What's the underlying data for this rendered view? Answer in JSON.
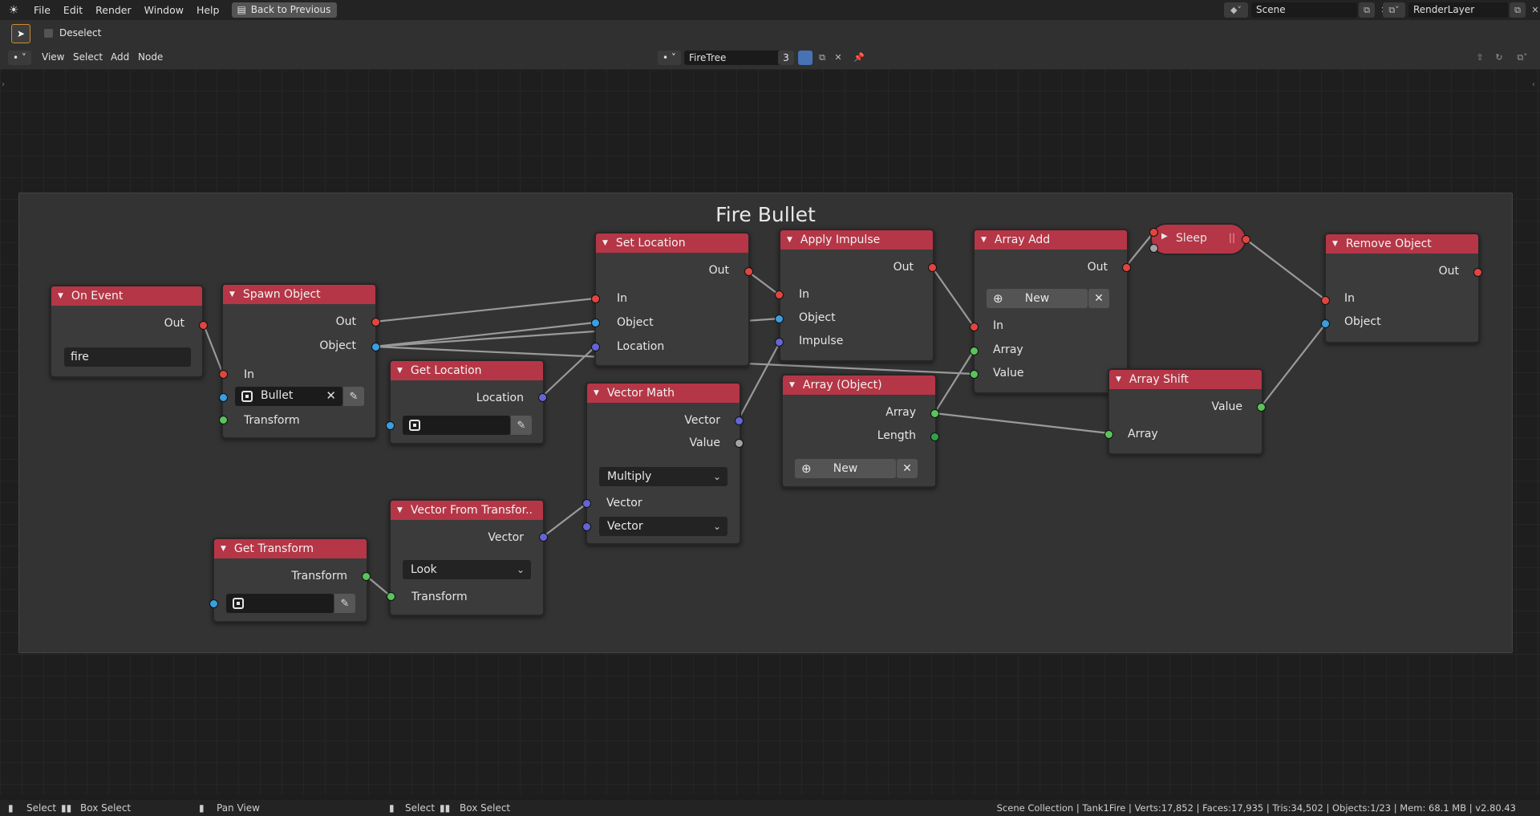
{
  "topbar": {
    "menus": [
      "File",
      "Edit",
      "Render",
      "Window",
      "Help"
    ],
    "back_button": "Back to Previous",
    "scene": "Scene",
    "render_layer": "RenderLayer"
  },
  "toolbar": {
    "deselect": "Deselect"
  },
  "node_header": {
    "menus": [
      "View",
      "Select",
      "Add",
      "Node"
    ],
    "tree_name": "FireTree",
    "users": "3"
  },
  "frame": {
    "title": "Fire Bullet"
  },
  "nodes": {
    "on_event": {
      "title": "On Event",
      "out": "Out",
      "value": "fire"
    },
    "spawn_object": {
      "title": "Spawn Object",
      "out": "Out",
      "object": "Object",
      "in": "In",
      "obj_value": "Bullet",
      "transform": "Transform"
    },
    "get_location": {
      "title": "Get Location",
      "location": "Location"
    },
    "get_transform": {
      "title": "Get Transform",
      "transform": "Transform"
    },
    "vector_from_transform": {
      "title": "Vector From Transfor..",
      "vector": "Vector",
      "mode": "Look",
      "transform": "Transform"
    },
    "set_location": {
      "title": "Set Location",
      "out": "Out",
      "in": "In",
      "object": "Object",
      "location": "Location"
    },
    "vector_math": {
      "title": "Vector Math",
      "vector_out": "Vector",
      "value_out": "Value",
      "operation": "Multiply",
      "vector_in": "Vector",
      "vector_mode": "Vector"
    },
    "apply_impulse": {
      "title": "Apply Impulse",
      "out": "Out",
      "in": "In",
      "object": "Object",
      "impulse": "Impulse"
    },
    "array_object": {
      "title": "Array (Object)",
      "array": "Array",
      "length": "Length",
      "new": "New"
    },
    "array_add": {
      "title": "Array Add",
      "out": "Out",
      "new": "New",
      "in": "In",
      "array": "Array",
      "value": "Value"
    },
    "sleep": {
      "title": "Sleep"
    },
    "array_shift": {
      "title": "Array Shift",
      "value": "Value",
      "array": "Array"
    },
    "remove_object": {
      "title": "Remove Object",
      "out": "Out",
      "in": "In",
      "object": "Object"
    }
  },
  "statusbar": {
    "left": [
      "Select",
      "Box Select",
      "Pan View",
      "Select",
      "Box Select"
    ],
    "stats": "Scene Collection | Tank1Fire | Verts:17,852 | Faces:17,935 | Tris:34,502 | Objects:1/23 | Mem: 68.1 MB | v2.80.43"
  },
  "colors": {
    "node_header": "#b53646",
    "frame": "#333333",
    "accent": "#d08a2b"
  }
}
